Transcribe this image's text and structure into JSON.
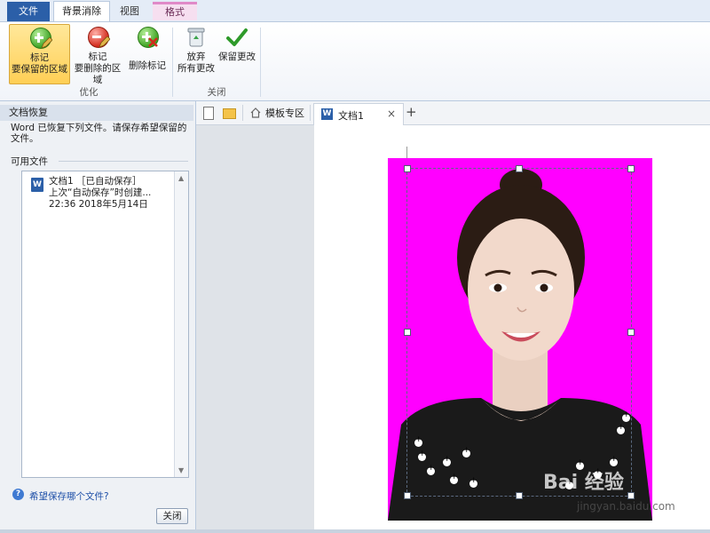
{
  "tabs": {
    "file": "文件",
    "background_removal": "背景消除",
    "view": "视图",
    "format": "格式"
  },
  "ribbon": {
    "mark_keep": [
      "标记",
      "要保留的区域"
    ],
    "mark_remove": [
      "标记",
      "要删除的区域"
    ],
    "delete_mark": "删除标记",
    "discard": [
      "放弃",
      "所有更改"
    ],
    "keep_changes": "保留更改",
    "group_optimize": "优化",
    "group_close": "关闭"
  },
  "recovery_pane": {
    "title": "文档恢复",
    "message": "Word 已恢复下列文件。请保存希望保留的文件。",
    "available_files": "可用文件",
    "file": {
      "name": "文档1 ［已自动保存］",
      "line2": "上次“自动保存”时创建...",
      "timestamp": "22:36 2018年5月14日"
    },
    "help_link": "希望保存哪个文件?",
    "close_button": "关闭"
  },
  "doc_tabs": {
    "template_zone": "模板专区",
    "document": "文档1",
    "close_glyph": "×",
    "add_glyph": "+"
  },
  "icons": {
    "file_badge": "W",
    "help_badge": "?"
  },
  "watermark": {
    "main": "Bai 经验",
    "sub": "jingyan.baidu.com"
  },
  "colors": {
    "photo_background": "#ff00ff",
    "file_tab": "#2b5fa8"
  }
}
